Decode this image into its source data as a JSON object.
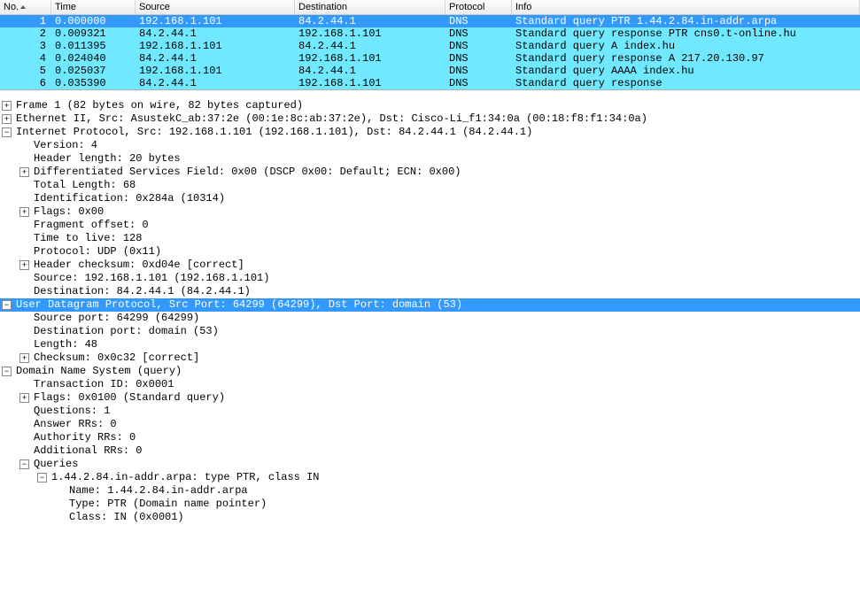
{
  "columns": {
    "no": "No.",
    "time": "Time",
    "source": "Source",
    "destination": "Destination",
    "protocol": "Protocol",
    "info": "Info"
  },
  "packets": [
    {
      "no": "1",
      "time": "0.000000",
      "src": "192.168.1.101",
      "dst": "84.2.44.1",
      "prot": "DNS",
      "info": "Standard query PTR 1.44.2.84.in-addr.arpa",
      "style": "row-selected"
    },
    {
      "no": "2",
      "time": "0.009321",
      "src": "84.2.44.1",
      "dst": "192.168.1.101",
      "prot": "DNS",
      "info": "Standard query response PTR cns0.t-online.hu",
      "style": "row-cyan"
    },
    {
      "no": "3",
      "time": "0.011395",
      "src": "192.168.1.101",
      "dst": "84.2.44.1",
      "prot": "DNS",
      "info": "Standard query A index.hu",
      "style": "row-cyan"
    },
    {
      "no": "4",
      "time": "0.024040",
      "src": "84.2.44.1",
      "dst": "192.168.1.101",
      "prot": "DNS",
      "info": "Standard query response A 217.20.130.97",
      "style": "row-cyan"
    },
    {
      "no": "5",
      "time": "0.025037",
      "src": "192.168.1.101",
      "dst": "84.2.44.1",
      "prot": "DNS",
      "info": "Standard query AAAA index.hu",
      "style": "row-cyan"
    },
    {
      "no": "6",
      "time": "0.035390",
      "src": "84.2.44.1",
      "dst": "192.168.1.101",
      "prot": "DNS",
      "info": "Standard query response",
      "style": "row-cyan"
    }
  ],
  "tree": [
    {
      "indent": 0,
      "icon": "plus",
      "text": "Frame 1 (82 bytes on wire, 82 bytes captured)"
    },
    {
      "indent": 0,
      "icon": "plus",
      "text": "Ethernet II, Src: AsustekC_ab:37:2e (00:1e:8c:ab:37:2e), Dst: Cisco-Li_f1:34:0a (00:18:f8:f1:34:0a)"
    },
    {
      "indent": 0,
      "icon": "minus",
      "text": "Internet Protocol, Src: 192.168.1.101 (192.168.1.101), Dst: 84.2.44.1 (84.2.44.1)"
    },
    {
      "indent": 1,
      "icon": "blank",
      "text": "Version: 4"
    },
    {
      "indent": 1,
      "icon": "blank",
      "text": "Header length: 20 bytes"
    },
    {
      "indent": 1,
      "icon": "plus",
      "text": "Differentiated Services Field: 0x00 (DSCP 0x00: Default; ECN: 0x00)"
    },
    {
      "indent": 1,
      "icon": "blank",
      "text": "Total Length: 68"
    },
    {
      "indent": 1,
      "icon": "blank",
      "text": "Identification: 0x284a (10314)"
    },
    {
      "indent": 1,
      "icon": "plus",
      "text": "Flags: 0x00"
    },
    {
      "indent": 1,
      "icon": "blank",
      "text": "Fragment offset: 0"
    },
    {
      "indent": 1,
      "icon": "blank",
      "text": "Time to live: 128"
    },
    {
      "indent": 1,
      "icon": "blank",
      "text": "Protocol: UDP (0x11)"
    },
    {
      "indent": 1,
      "icon": "plus",
      "text": "Header checksum: 0xd04e [correct]"
    },
    {
      "indent": 1,
      "icon": "blank",
      "text": "Source: 192.168.1.101 (192.168.1.101)"
    },
    {
      "indent": 1,
      "icon": "blank",
      "text": "Destination: 84.2.44.1 (84.2.44.1)"
    },
    {
      "indent": 0,
      "icon": "minus",
      "text": "User Datagram Protocol, Src Port: 64299 (64299), Dst Port: domain (53)",
      "highlight": true
    },
    {
      "indent": 1,
      "icon": "blank",
      "text": "Source port: 64299 (64299)"
    },
    {
      "indent": 1,
      "icon": "blank",
      "text": "Destination port: domain (53)"
    },
    {
      "indent": 1,
      "icon": "blank",
      "text": "Length: 48"
    },
    {
      "indent": 1,
      "icon": "plus",
      "text": "Checksum: 0x0c32 [correct]"
    },
    {
      "indent": 0,
      "icon": "minus",
      "text": "Domain Name System (query)"
    },
    {
      "indent": 1,
      "icon": "blank",
      "text": "Transaction ID: 0x0001"
    },
    {
      "indent": 1,
      "icon": "plus",
      "text": "Flags: 0x0100 (Standard query)"
    },
    {
      "indent": 1,
      "icon": "blank",
      "text": "Questions: 1"
    },
    {
      "indent": 1,
      "icon": "blank",
      "text": "Answer RRs: 0"
    },
    {
      "indent": 1,
      "icon": "blank",
      "text": "Authority RRs: 0"
    },
    {
      "indent": 1,
      "icon": "blank",
      "text": "Additional RRs: 0"
    },
    {
      "indent": 1,
      "icon": "minus",
      "text": "Queries"
    },
    {
      "indent": 2,
      "icon": "minus",
      "text": "1.44.2.84.in-addr.arpa: type PTR, class IN"
    },
    {
      "indent": 3,
      "icon": "blank",
      "text": "Name: 1.44.2.84.in-addr.arpa"
    },
    {
      "indent": 3,
      "icon": "blank",
      "text": "Type: PTR (Domain name pointer)"
    },
    {
      "indent": 3,
      "icon": "blank",
      "text": "Class: IN (0x0001)"
    }
  ]
}
